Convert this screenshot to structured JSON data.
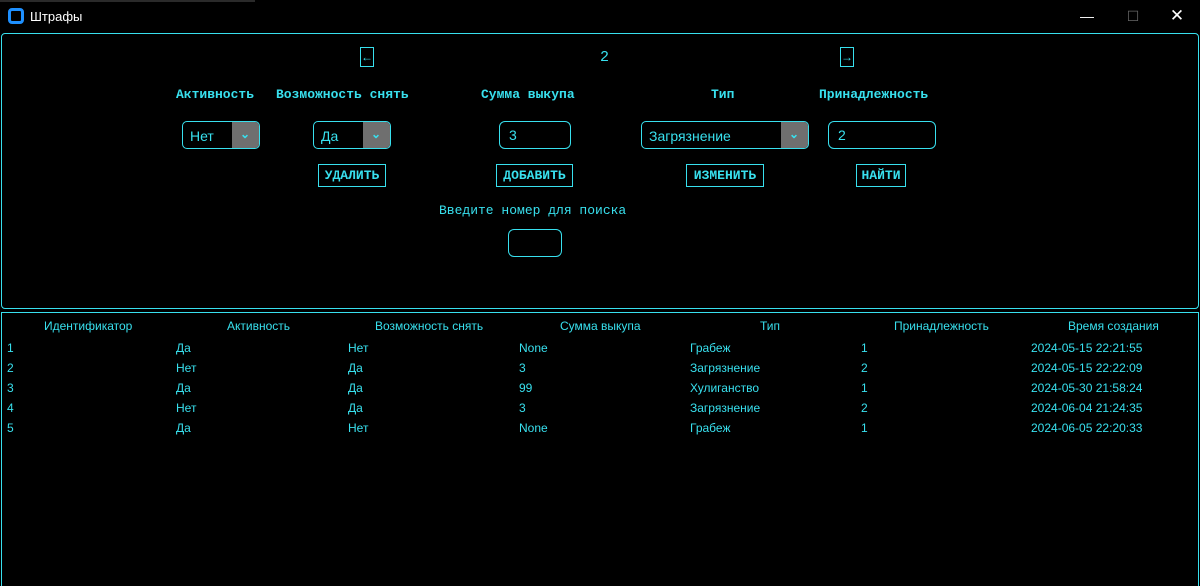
{
  "window": {
    "title": "Штрафы",
    "minimize_glyph": "—",
    "maximize_glyph": "☐",
    "close_glyph": "✕"
  },
  "navigation": {
    "prev_label": "←",
    "next_label": "→",
    "page_number": "2"
  },
  "form": {
    "labels": {
      "activity": "Активность",
      "removable": "Возможность снять",
      "ransom": "Сумма выкупа",
      "type": "Тип",
      "owner": "Принадлежность"
    },
    "activity_value": "Нет",
    "removable_value": "Да",
    "ransom_value": "3",
    "type_value": "Загрязнение",
    "owner_value": "2",
    "dropdown_glyph": "⌄"
  },
  "actions": {
    "delete_label": "УДАЛИТЬ",
    "add_label": "ДОБАВИТЬ",
    "edit_label": "ИЗМЕНИТЬ",
    "find_label": "НАЙТИ"
  },
  "search": {
    "label": "Введите номер для поиска",
    "value": ""
  },
  "table": {
    "headers": [
      "Идентификатор",
      "Активность",
      "Возможность снять",
      "Сумма выкупа",
      "Тип",
      "Принадлежность",
      "Время создания"
    ],
    "rows": [
      [
        "1",
        "Да",
        "Нет",
        "None",
        "Грабеж",
        "1",
        "2024-05-15 22:21:55"
      ],
      [
        "2",
        "Нет",
        "Да",
        "3",
        "Загрязнение",
        "2",
        "2024-05-15 22:22:09"
      ],
      [
        "3",
        "Да",
        "Да",
        "99",
        "Хулиганство",
        "1",
        "2024-05-30 21:58:24"
      ],
      [
        "4",
        "Нет",
        "Да",
        "3",
        "Загрязнение",
        "2",
        "2024-06-04 21:24:35"
      ],
      [
        "5",
        "Да",
        "Нет",
        "None",
        "Грабеж",
        "1",
        "2024-06-05 22:20:33"
      ]
    ]
  },
  "colors": {
    "accent": "#38e0ee",
    "background": "#000000",
    "dropdown_button": "#6f6f6f"
  }
}
